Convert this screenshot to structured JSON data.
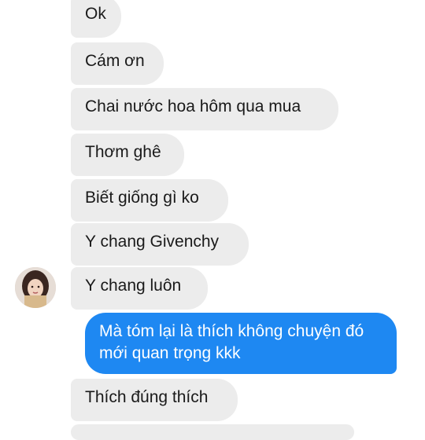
{
  "conversation": {
    "incoming": [
      {
        "text": "Ok"
      },
      {
        "text": "Cám ơn"
      },
      {
        "text": "Chai nước hoa hôm qua mua"
      },
      {
        "text": "Thơm ghê"
      },
      {
        "text": "Biết giống gì ko"
      },
      {
        "text": "Y chang Givenchy"
      },
      {
        "text": "Y chang luôn"
      }
    ],
    "outgoing": {
      "text": "Mà tóm lại là thích không chuyện đó mới quan trọng kkk"
    },
    "reply": {
      "text": "Thích đúng thích"
    }
  },
  "colors": {
    "incoming_bubble": "#ececec",
    "outgoing_bubble": "#1e88f2",
    "incoming_text": "#1a1a1a",
    "outgoing_text": "#ffffff"
  },
  "icons": {
    "avatar": "contact-avatar-photo"
  }
}
